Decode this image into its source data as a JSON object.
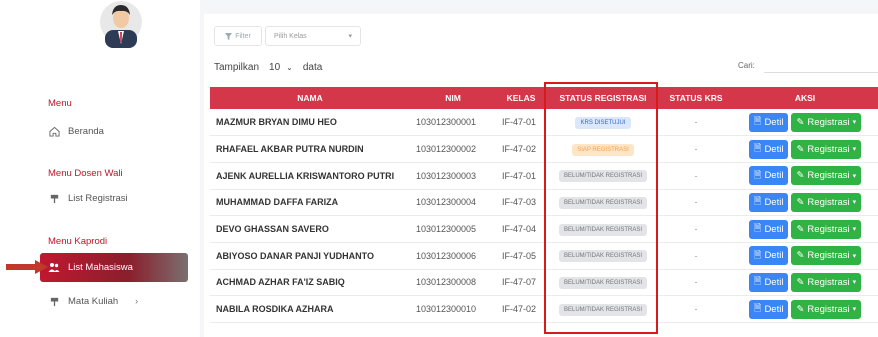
{
  "sidebar": {
    "sections": {
      "menu": "Menu",
      "dosen_wali": "Menu Dosen Wali",
      "kaprodi": "Menu Kaprodi"
    },
    "items": {
      "beranda": "Beranda",
      "list_registrasi": "List Registrasi",
      "list_mahasiswa": "List Mahasiswa",
      "mata_kuliah": "Mata Kuliah"
    }
  },
  "toolbar": {
    "filter_label": "Filter",
    "kelas_placeholder": "Pilih Kelas",
    "show_prefix": "Tampilkan",
    "show_value": "10",
    "show_suffix": "data",
    "search_label": "Cari:"
  },
  "table": {
    "headers": [
      "NAMA",
      "NIM",
      "KELAS",
      "STATUS REGISTRASI",
      "STATUS KRS",
      "AKSI"
    ],
    "rows": [
      {
        "nama": "MAZMUR BRYAN DIMU HEO",
        "nim": "103012300001",
        "kelas": "IF-47-01",
        "status": "KRS DISETUJUI",
        "krs": "-"
      },
      {
        "nama": "RHAFAEL AKBAR PUTRA NURDIN",
        "nim": "103012300002",
        "kelas": "IF-47-02",
        "status": "SIAP REGISTRASI",
        "krs": "-"
      },
      {
        "nama": "AJENK AURELLIA KRISWANTORO PUTRI",
        "nim": "103012300003",
        "kelas": "IF-47-01",
        "status": "BELUM/TIDAK REGISTRASI",
        "krs": "-"
      },
      {
        "nama": "MUHAMMAD DAFFA FARIZA",
        "nim": "103012300004",
        "kelas": "IF-47-03",
        "status": "BELUM/TIDAK REGISTRASI",
        "krs": "-"
      },
      {
        "nama": "DEVO GHASSAN SAVERO",
        "nim": "103012300005",
        "kelas": "IF-47-04",
        "status": "BELUM/TIDAK REGISTRASI",
        "krs": "-"
      },
      {
        "nama": "ABIYOSO DANAR PANJI YUDHANTO",
        "nim": "103012300006",
        "kelas": "IF-47-05",
        "status": "BELUM/TIDAK REGISTRASI",
        "krs": "-"
      },
      {
        "nama": "ACHMAD AZHAR FA'IZ SABIQ",
        "nim": "103012300008",
        "kelas": "IF-47-07",
        "status": "BELUM/TIDAK REGISTRASI",
        "krs": "-"
      },
      {
        "nama": "NABILA ROSDIKA AZHARA",
        "nim": "103012300010",
        "kelas": "IF-47-02",
        "status": "BELUM/TIDAK REGISTRASI",
        "krs": "-"
      }
    ],
    "detil_label": "Detil",
    "registrasi_label": "Registrasi"
  },
  "colors": {
    "brand_red": "#d4364a",
    "detil_blue": "#3b86f5",
    "registrasi_green": "#2fb344",
    "highlight_box": "#d61b1b"
  }
}
